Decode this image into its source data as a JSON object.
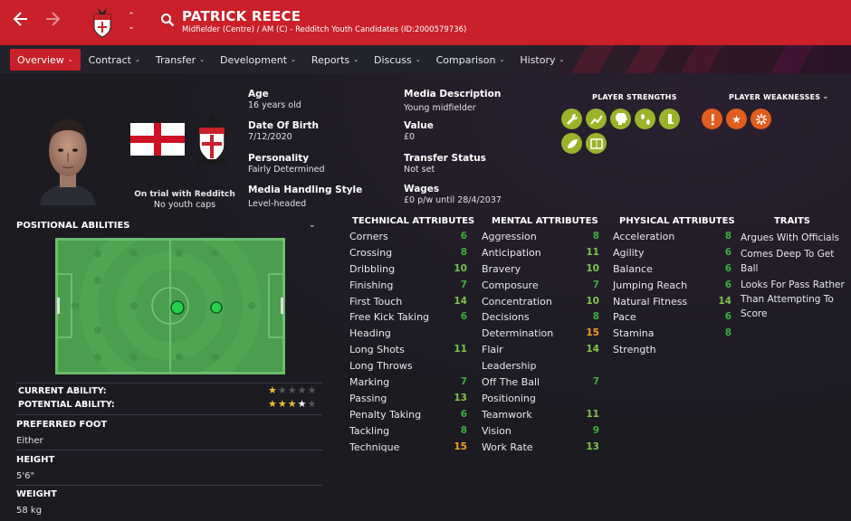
{
  "header": {
    "player_name": "PATRICK REECE",
    "subtitle": "Midfielder (Centre) / AM (C) - Redditch Youth Candidates (ID:2000579736)",
    "accent_color": "#c9202a",
    "icons": [
      "back-arrow-icon",
      "forward-arrow-icon",
      "club-crest-icon",
      "updown-icon",
      "search-icon"
    ]
  },
  "menu": [
    {
      "label": "Overview",
      "active": true
    },
    {
      "label": "Contract"
    },
    {
      "label": "Transfer"
    },
    {
      "label": "Development"
    },
    {
      "label": "Reports"
    },
    {
      "label": "Discuss"
    },
    {
      "label": "Comparison"
    },
    {
      "label": "History"
    }
  ],
  "profile": {
    "trial_title": "On trial with Redditch",
    "trial_sub": "No youth caps",
    "nation_flag": "england-flag",
    "age_label": "Age",
    "age": "16 years old",
    "dob_label": "Date Of Birth",
    "dob": "7/12/2020",
    "personality_label": "Personality",
    "personality": "Fairly Determined",
    "media_style_label": "Media Handling Style",
    "media_style": "Level-headed",
    "media_desc_label": "Media Description",
    "media_desc": "Young midfielder",
    "value_label": "Value",
    "value": "£0",
    "transfer_label": "Transfer Status",
    "transfer": "Not set",
    "wages_label": "Wages",
    "wages": "£0 p/w until 28/4/2037"
  },
  "strengths": {
    "title": "PLAYER STRENGTHS",
    "color": "#9ab32a",
    "icons": [
      "wrench-icon",
      "chart-up-icon",
      "head-icon",
      "footprints-icon",
      "foot-icon",
      "boot-icon",
      "pitch-icon"
    ]
  },
  "weaknesses": {
    "title": "PLAYER WEAKNESSES",
    "color": "#e05d1e",
    "icons": [
      "exclamation-icon",
      "star-icon",
      "burst-icon"
    ]
  },
  "positional": {
    "title": "POSITIONAL ABILITIES",
    "current_label": "CURRENT ABILITY:",
    "potential_label": "POTENTIAL ABILITY:",
    "current_stars": 0.5,
    "potential_stars": 3.5
  },
  "details": {
    "foot_label": "PREFERRED FOOT",
    "foot": "Either",
    "height_label": "HEIGHT",
    "height": "5'6\"",
    "weight_label": "WEIGHT",
    "weight": "58 kg"
  },
  "technical": {
    "title": "TECHNICAL ATTRIBUTES",
    "rows": [
      {
        "n": "Corners",
        "v": "6",
        "c": "g"
      },
      {
        "n": "Crossing",
        "v": "8",
        "c": "g"
      },
      {
        "n": "Dribbling",
        "v": "10",
        "c": "lg"
      },
      {
        "n": "Finishing",
        "v": "7",
        "c": "g"
      },
      {
        "n": "First Touch",
        "v": "14",
        "c": "lg"
      },
      {
        "n": "Free Kick Taking",
        "v": "6",
        "c": "g"
      },
      {
        "n": "Heading",
        "v": "",
        "c": "g"
      },
      {
        "n": "Long Shots",
        "v": "11",
        "c": "lg"
      },
      {
        "n": "Long Throws",
        "v": "",
        "c": "g"
      },
      {
        "n": "Marking",
        "v": "7",
        "c": "g"
      },
      {
        "n": "Passing",
        "v": "13",
        "c": "lg"
      },
      {
        "n": "Penalty Taking",
        "v": "6",
        "c": "g"
      },
      {
        "n": "Tackling",
        "v": "8",
        "c": "g"
      },
      {
        "n": "Technique",
        "v": "15",
        "c": "o"
      }
    ]
  },
  "mental": {
    "title": "MENTAL ATTRIBUTES",
    "rows": [
      {
        "n": "Aggression",
        "v": "8",
        "c": "g"
      },
      {
        "n": "Anticipation",
        "v": "11",
        "c": "lg"
      },
      {
        "n": "Bravery",
        "v": "10",
        "c": "lg"
      },
      {
        "n": "Composure",
        "v": "7",
        "c": "g"
      },
      {
        "n": "Concentration",
        "v": "10",
        "c": "lg"
      },
      {
        "n": "Decisions",
        "v": "8",
        "c": "g"
      },
      {
        "n": "Determination",
        "v": "15",
        "c": "o"
      },
      {
        "n": "Flair",
        "v": "14",
        "c": "lg"
      },
      {
        "n": "Leadership",
        "v": "",
        "c": "g"
      },
      {
        "n": "Off The Ball",
        "v": "7",
        "c": "g"
      },
      {
        "n": "Positioning",
        "v": "",
        "c": "g"
      },
      {
        "n": "Teamwork",
        "v": "11",
        "c": "lg"
      },
      {
        "n": "Vision",
        "v": "9",
        "c": "g"
      },
      {
        "n": "Work Rate",
        "v": "13",
        "c": "lg"
      }
    ]
  },
  "physical": {
    "title": "PHYSICAL ATTRIBUTES",
    "rows": [
      {
        "n": "Acceleration",
        "v": "8",
        "c": "g"
      },
      {
        "n": "Agility",
        "v": "6",
        "c": "g"
      },
      {
        "n": "Balance",
        "v": "6",
        "c": "g"
      },
      {
        "n": "Jumping Reach",
        "v": "6",
        "c": "g"
      },
      {
        "n": "Natural Fitness",
        "v": "14",
        "c": "lg"
      },
      {
        "n": "Pace",
        "v": "6",
        "c": "g"
      },
      {
        "n": "Stamina",
        "v": "8",
        "c": "g"
      },
      {
        "n": "Strength",
        "v": "",
        "c": "g"
      }
    ]
  },
  "traits": {
    "title": "TRAITS",
    "items": [
      "Argues With Officials",
      "Comes Deep To Get Ball",
      "Looks For Pass Rather Than Attempting To Score"
    ]
  }
}
